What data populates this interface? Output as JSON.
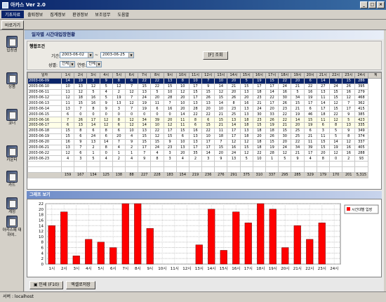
{
  "window": {
    "title": "아카스 Ver 2.0"
  },
  "menu": [
    "기초자료",
    "출퇴정보",
    "집계정보",
    "환경정보",
    "보조업무",
    "도움말"
  ],
  "toolbar": {
    "back_label": "바로가기"
  },
  "sidebar": [
    {
      "label": "입장권",
      "icon": "document-icon"
    },
    {
      "label": "상품",
      "icon": "document-icon"
    },
    {
      "label": "코너",
      "icon": "document-icon"
    },
    {
      "label": "카운터",
      "icon": "document-icon"
    },
    {
      "label": "카드",
      "icon": "document-icon"
    },
    {
      "label": "계정",
      "icon": "document-icon"
    },
    {
      "label": "아카스에 대하여..",
      "icon": "document-icon"
    }
  ],
  "pane": {
    "title": "일자별 시간대입장현황"
  },
  "conditions": {
    "title": "행합조건",
    "period_label": "기간:",
    "date_from": "2003-06-02",
    "date_sep": "~",
    "date_to": "2003-06-25",
    "gender_label": "성별:",
    "gender_value": "전체",
    "age_label": "연령:",
    "age_value": "전체",
    "search_button": "[F] 조회"
  },
  "table": {
    "headers": [
      "일자",
      "1시",
      "2시",
      "3시",
      "4시",
      "5시",
      "6시",
      "7시",
      "8시",
      "9시",
      "10시",
      "11시",
      "12시",
      "13시",
      "14시",
      "15시",
      "16시",
      "17시",
      "18시",
      "19시",
      "20시",
      "21시",
      "22시",
      "23시",
      "24시",
      "계"
    ],
    "rows": [
      [
        "2003-06-09",
        "14",
        "19",
        "3",
        "9",
        "8",
        "6",
        "22",
        "22",
        "13",
        "8",
        "10",
        "7",
        "10",
        "20",
        "5",
        "19",
        "15",
        "22",
        "20",
        "6",
        "14",
        "9",
        "15",
        "286"
      ],
      [
        "2003-06-10",
        "10",
        "13",
        "12",
        "5",
        "12",
        "7",
        "15",
        "22",
        "15",
        "10",
        "17",
        "9",
        "14",
        "21",
        "15",
        "17",
        "17",
        "24",
        "21",
        "22",
        "27",
        "24",
        "26",
        "395"
      ],
      [
        "2003-06-11",
        "11",
        "12",
        "5",
        "4",
        "2",
        "12",
        "13",
        "5",
        "10",
        "12",
        "15",
        "15",
        "12",
        "20",
        "13",
        "18",
        "14",
        "16",
        "5",
        "16",
        "13",
        "15",
        "16",
        "279"
      ],
      [
        "2003-06-12",
        "12",
        "18",
        "16",
        "5",
        "19",
        "7",
        "24",
        "20",
        "28",
        "20",
        "17",
        "26",
        "15",
        "26",
        "20",
        "23",
        "22",
        "30",
        "34",
        "19",
        "11",
        "15",
        "12",
        "468"
      ],
      [
        "2003-06-13",
        "11",
        "15",
        "16",
        "9",
        "13",
        "12",
        "19",
        "11",
        "7",
        "10",
        "13",
        "13",
        "14",
        "8",
        "16",
        "21",
        "17",
        "26",
        "15",
        "17",
        "14",
        "12",
        "7",
        "362"
      ],
      [
        "2003-06-14",
        "13",
        "7",
        "8",
        "9",
        "3",
        "7",
        "19",
        "6",
        "16",
        "20",
        "28",
        "20",
        "10",
        "23",
        "13",
        "24",
        "20",
        "23",
        "21",
        "6",
        "17",
        "15",
        "17",
        "415"
      ],
      [
        "2003-06-15",
        "6",
        "0",
        "0",
        "0",
        "0",
        "0",
        "0",
        "0",
        "0",
        "14",
        "22",
        "22",
        "21",
        "25",
        "13",
        "30",
        "33",
        "22",
        "19",
        "46",
        "18",
        "22",
        "9",
        "385"
      ],
      [
        "2003-06-16",
        "7",
        "26",
        "17",
        "12",
        "8",
        "12",
        "34",
        "39",
        "20",
        "11",
        "8",
        "6",
        "15",
        "13",
        "18",
        "23",
        "26",
        "22",
        "14",
        "15",
        "11",
        "12",
        "5",
        "423"
      ],
      [
        "2003-06-17",
        "6",
        "13",
        "14",
        "12",
        "6",
        "12",
        "14",
        "10",
        "12",
        "11",
        "6",
        "15",
        "21",
        "14",
        "18",
        "15",
        "19",
        "21",
        "20",
        "19",
        "6",
        "8",
        "13",
        "335"
      ],
      [
        "2003-06-18",
        "15",
        "8",
        "6",
        "8",
        "6",
        "10",
        "13",
        "22",
        "17",
        "15",
        "16",
        "22",
        "11",
        "17",
        "13",
        "18",
        "18",
        "15",
        "25",
        "6",
        "3",
        "5",
        "9",
        "349"
      ],
      [
        "2003-06-19",
        "15",
        "6",
        "24",
        "6",
        "20",
        "4",
        "15",
        "12",
        "15",
        "6",
        "13",
        "10",
        "18",
        "17",
        "18",
        "20",
        "26",
        "30",
        "25",
        "21",
        "11",
        "5",
        "8",
        "374"
      ],
      [
        "2003-06-20",
        "16",
        "9",
        "13",
        "14",
        "7",
        "9",
        "15",
        "15",
        "9",
        "10",
        "13",
        "17",
        "7",
        "12",
        "12",
        "18",
        "15",
        "20",
        "22",
        "11",
        "15",
        "14",
        "12",
        "337"
      ],
      [
        "2003-06-21",
        "13",
        "7",
        "2",
        "8",
        "4",
        "2",
        "17",
        "24",
        "23",
        "13",
        "17",
        "17",
        "15",
        "16",
        "15",
        "18",
        "19",
        "24",
        "34",
        "39",
        "15",
        "19",
        "16",
        "405"
      ],
      [
        "2003-06-22",
        "12",
        "6",
        "1",
        "0",
        "1",
        "1",
        "7",
        "4",
        "3",
        "20",
        "35",
        "14",
        "20",
        "24",
        "12",
        "22",
        "28",
        "12",
        "21",
        "17",
        "20",
        "12",
        "16",
        "288"
      ],
      [
        "2003-06-23",
        "4",
        "3",
        "5",
        "4",
        "2",
        "4",
        "9",
        "8",
        "3",
        "4",
        "2",
        "3",
        "9",
        "13",
        "5",
        "10",
        "1",
        "5",
        "9",
        "4",
        "8",
        "0",
        "2",
        "93"
      ],
      [
        "",
        "",
        "",
        "",
        "",
        "",
        "",
        "",
        "",
        "",
        "",
        "",
        "",
        "",
        "",
        "",
        "",
        "",
        "",
        "",
        "",
        "",
        "",
        "",
        ""
      ],
      [
        "",
        "",
        "",
        "",
        "",
        "",
        "",
        "",
        "",
        "",
        "",
        "",
        "",
        "",
        "",
        "",
        "",
        "",
        "",
        "",
        "",
        "",
        "",
        "",
        ""
      ]
    ],
    "total": [
      "",
      "159",
      "167",
      "134",
      "125",
      "138",
      "88",
      "227",
      "228",
      "183",
      "154",
      "219",
      "236",
      "276",
      "291",
      "375",
      "310",
      "337",
      "295",
      "285",
      "329",
      "179",
      "170",
      "201",
      "5,315"
    ]
  },
  "chart_section": {
    "title": "그래프 보기"
  },
  "chart_data": {
    "type": "bar",
    "categories": [
      "1시",
      "2시",
      "3시",
      "4시",
      "5시",
      "6시",
      "7시",
      "8시",
      "9시",
      "10시",
      "11시",
      "12시",
      "13시",
      "14시",
      "15시",
      "16시",
      "17시",
      "18시",
      "19시",
      "20시",
      "21시",
      "22시",
      "23시",
      "24시"
    ],
    "series": [
      {
        "name": "시간대별 입장",
        "values": [
          14,
          19,
          3,
          9,
          8,
          6,
          22,
          22,
          13,
          0,
          0,
          0,
          7,
          20,
          5,
          19,
          15,
          22,
          20,
          6,
          14,
          9,
          15,
          0
        ],
        "color": "#ff0000"
      }
    ],
    "ylim": [
      0,
      22
    ],
    "yticks": [
      0,
      2,
      4,
      6,
      8,
      10,
      12,
      14,
      16,
      18,
      20,
      22
    ],
    "grid": true,
    "legend_position": "top-right"
  },
  "bottom": {
    "print_button": "인쇄 (F10)",
    "excel_button": "엑셀로저장"
  },
  "status": {
    "server": "서버 : localhost"
  },
  "colors": {
    "title_bar": "#0a246a",
    "selected_row": "#0a246a",
    "bar": "#ff0000"
  }
}
